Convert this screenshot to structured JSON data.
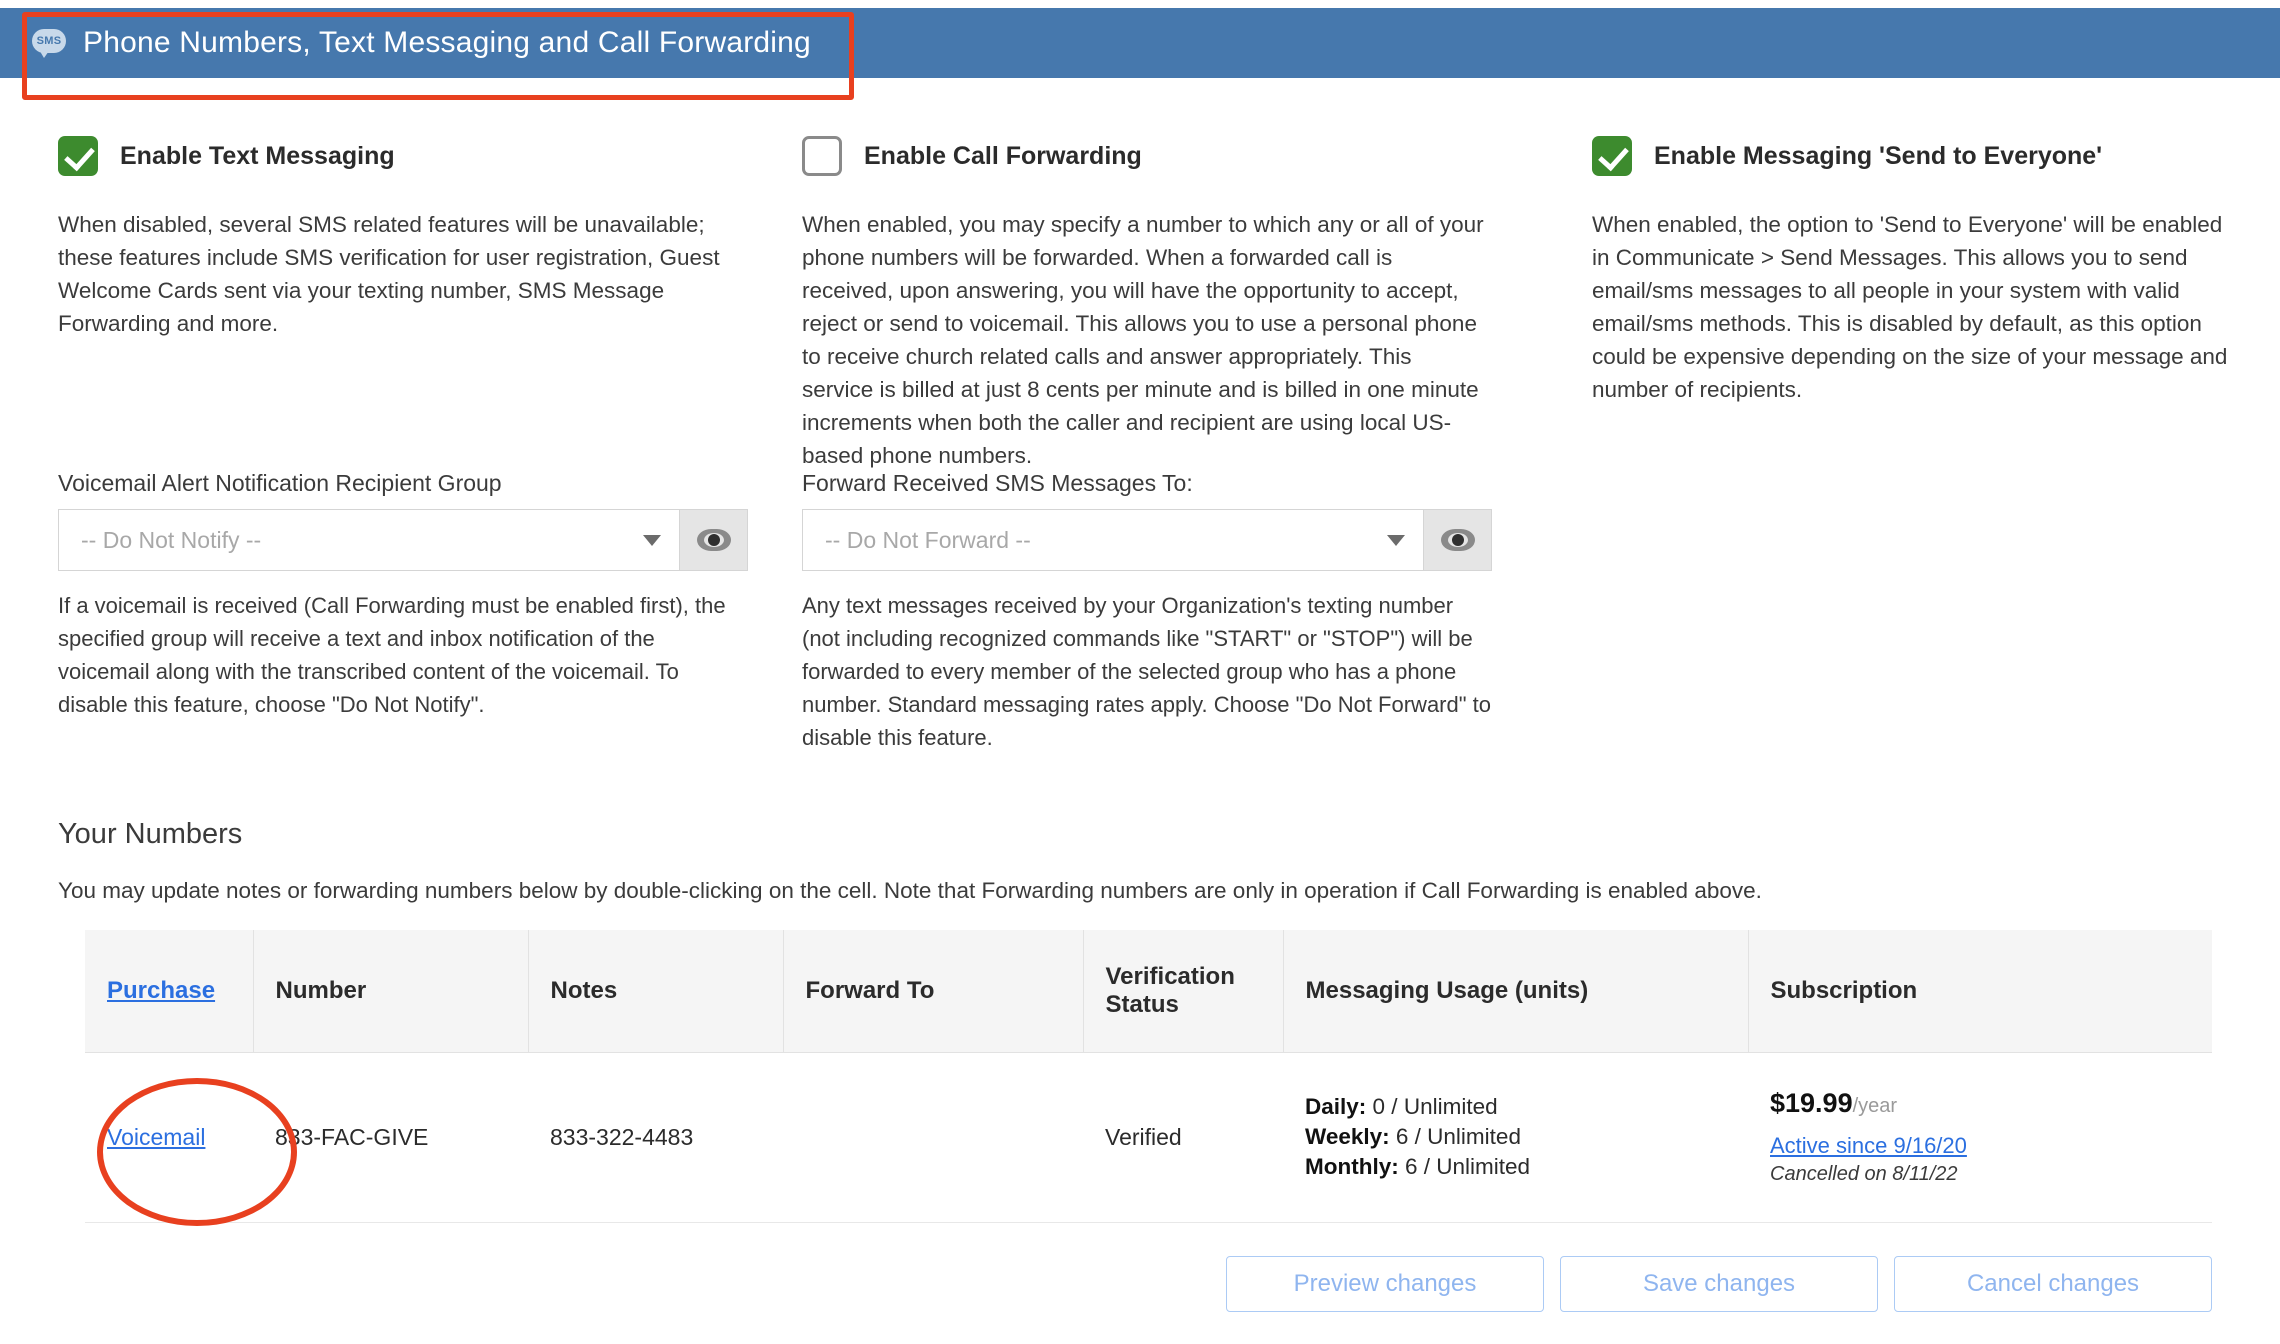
{
  "header": {
    "title": "Phone Numbers, Text Messaging and Call Forwarding",
    "icon": "sms-bubble-icon",
    "icon_text": "SMS",
    "background_color": "#4678ad"
  },
  "annotations": {
    "rect_color": "#e8401f",
    "ellipse_color": "#e8401f"
  },
  "options": [
    {
      "label": "Enable Text Messaging",
      "checked": true,
      "description": "When disabled, several SMS related features will be unavailable; these features include SMS verification for user registration, Guest Welcome Cards sent via your texting number, SMS Message Forwarding and more."
    },
    {
      "label": "Enable Call Forwarding",
      "checked": false,
      "description": "When enabled, you may specify a number to which any or all of your phone numbers will be forwarded. When a forwarded call is received, upon answering, you will have the opportunity to accept, reject or send to voicemail. This allows you to use a personal phone to receive church related calls and answer appropriately. This service is billed at just 8 cents per minute and is billed in one minute increments when both the caller and recipient are using local US-based phone numbers."
    },
    {
      "label": "Enable Messaging 'Send to Everyone'",
      "checked": true,
      "description": "When enabled, the option to 'Send to Everyone' will be enabled in Communicate > Send Messages. This allows you to send email/sms messages to all people in your system with valid email/sms methods. This is disabled by default, as this option could be expensive depending on the size of your message and number of recipients."
    }
  ],
  "selects": [
    {
      "label": "Voicemail Alert Notification Recipient Group",
      "value": "-- Do Not Notify --",
      "eye_icon": "eye-icon",
      "helper": "If a voicemail is received (Call Forwarding must be enabled first), the specified group will receive a text and inbox notification of the voicemail along with the transcribed content of the voicemail. To disable this feature, choose \"Do Not Notify\"."
    },
    {
      "label": "Forward Received SMS Messages To:",
      "value": "-- Do Not Forward --",
      "eye_icon": "eye-icon",
      "helper": "Any text messages received by your Organization's texting number (not including recognized commands like \"START\" or \"STOP\") will be forwarded to every member of the selected group who has a phone number. Standard messaging rates apply. Choose \"Do Not Forward\" to disable this feature."
    }
  ],
  "your_numbers": {
    "title": "Your Numbers",
    "subtitle": "You may update notes or forwarding numbers below by double-clicking on the cell. Note that Forwarding numbers are only in operation if Call Forwarding is enabled above.",
    "columns": [
      "Purchase",
      "Number",
      "Notes",
      "Forward To",
      "Verification Status",
      "Messaging Usage (units)",
      "Subscription"
    ],
    "rows": [
      {
        "purchase": "Voicemail",
        "number": "833-FAC-GIVE",
        "notes": "833-322-4483",
        "forward_to": "",
        "verification_status": "Verified",
        "usage": {
          "daily_label": "Daily:",
          "daily_value": "0 / Unlimited",
          "weekly_label": "Weekly:",
          "weekly_value": "6 / Unlimited",
          "monthly_label": "Monthly:",
          "monthly_value": "6 / Unlimited"
        },
        "subscription": {
          "price": "$19.99",
          "period": "/year",
          "status_link": "Active since 9/16/20",
          "cancelled": "Cancelled on 8/11/22"
        }
      }
    ]
  },
  "footer": {
    "preview_label": "Preview changes",
    "save_label": "Save changes",
    "cancel_label": "Cancel changes"
  }
}
